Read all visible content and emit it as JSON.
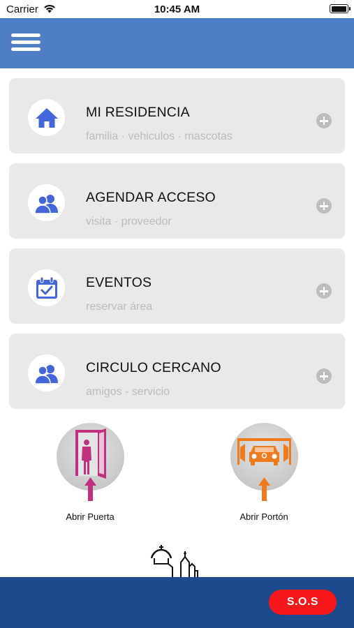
{
  "status_bar": {
    "carrier": "Carrier",
    "time": "10:45 AM",
    "battery_level": 0.9
  },
  "navbar": {
    "menu_icon": "hamburger-menu-icon",
    "color": "#4e7ec4"
  },
  "cards": [
    {
      "title": "MI RESIDENCIA",
      "subtitle": "familia · vehiculos · mascotas",
      "icon": "house-icon"
    },
    {
      "title": "AGENDAR ACCESO",
      "subtitle": "visita · proveedor",
      "icon": "people-icon"
    },
    {
      "title": "EVENTOS",
      "subtitle": "reservar área",
      "icon": "calendar-check-icon"
    },
    {
      "title": "CIRCULO CERCANO",
      "subtitle": "amigos - servicio",
      "icon": "people-icon"
    }
  ],
  "actions": [
    {
      "label": "Abrir Puerta",
      "icon": "open-door-icon",
      "color": "#c0317d"
    },
    {
      "label": "Abrir Portón",
      "icon": "garage-gate-icon",
      "color": "#f07a1e"
    }
  ],
  "bottom_bar": {
    "sos_label": "S.O.S",
    "color": "#1d4a8c",
    "sos_color": "#f5171b"
  },
  "accent_color": "#4366d8"
}
